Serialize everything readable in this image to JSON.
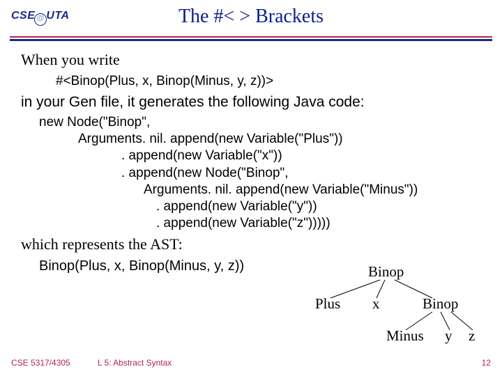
{
  "logo": {
    "pre": "CSE",
    "post": "UTA"
  },
  "title": "The #< > Brackets",
  "para1": "When you write",
  "code1": "#<Binop(Plus, x, Binop(Minus, y, z))>",
  "para2": "in your Gen file, it generates the following Java code:",
  "code2": {
    "l1": "new Node(\"Binop\",",
    "l2": "Arguments. nil. append(new Variable(\"Plus\"))",
    "l3": ". append(new Variable(\"x\"))",
    "l4": ". append(new Node(\"Binop\",",
    "l5": "Arguments. nil. append(new Variable(\"Minus\"))",
    "l6": ". append(new Variable(\"y\"))",
    "l7": ". append(new Variable(\"z\")))))"
  },
  "para3": "which represents the AST:",
  "ast_expr": "Binop(Plus, x, Binop(Minus, y, z))",
  "tree": {
    "root": "Binop",
    "l1a": "Plus",
    "l1b": "x",
    "l1c": "Binop",
    "l2a": "Minus",
    "l2b": "y",
    "l2c": "z"
  },
  "footer": {
    "course": "CSE 5317/4305",
    "lecture": "L 5: Abstract Syntax",
    "page": "12"
  }
}
